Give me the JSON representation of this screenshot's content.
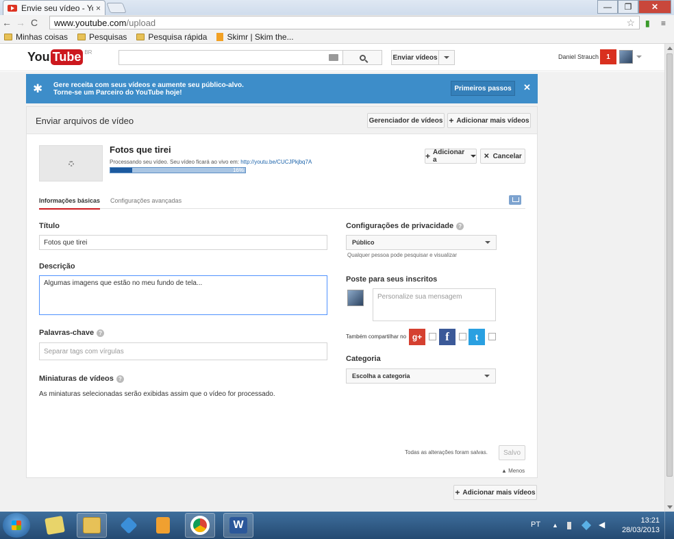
{
  "browser": {
    "tab_title": "Envie seu vídeo - You",
    "tab_close": "×",
    "url_host": "www.youtube.com",
    "url_path": "/upload",
    "window_controls": {
      "minimize": "—",
      "maximize": "❐",
      "close": "✕"
    },
    "nav": {
      "back": "←",
      "forward": "→",
      "reload": "C"
    },
    "bookmarks": [
      "Minhas coisas",
      "Pesquisas",
      "Pesquisa rápida",
      "Skimr | Skim the..."
    ]
  },
  "youtube_header": {
    "logo_you": "You",
    "logo_tube": "Tube",
    "logo_region": "BR",
    "search_placeholder": "",
    "upload_button": "Enviar vídeos",
    "username": "Daniel Strauch",
    "notification_count": "1"
  },
  "partner_banner": {
    "line1": "Gere receita com seus vídeos e aumente seu público-alvo.",
    "line2": "Torne-se um Parceiro do YouTube hoje!",
    "button": "Primeiros passos",
    "close": "✕"
  },
  "upload_panel": {
    "title": "Enviar arquivos de vídeo",
    "manager_button": "Gerenciador de vídeos",
    "add_more_button": "Adicionar mais vídeos",
    "plus": "+",
    "video": {
      "title": "Fotos que tirei",
      "processing_text": "Processando seu vídeo. Seu vídeo ficará ao vivo em:",
      "link": "http://youtu.be/CUCJPkjbq7A",
      "progress_label": "16%",
      "progress_value": 0.16
    },
    "add_to_button": "Adicionar a",
    "cancel_button": "Cancelar",
    "x": "✕",
    "tabs": {
      "basic": "Informações básicas",
      "advanced": "Configurações avançadas"
    },
    "form": {
      "title_label": "Título",
      "title_value": "Fotos que tirei",
      "description_label": "Descrição",
      "description_value": "Algumas imagens que estão no meu fundo de tela...",
      "tags_label": "Palavras-chave",
      "tags_placeholder": "Separar tags com vírgulas",
      "thumbnails_label": "Miniaturas de vídeos",
      "thumbnails_note": "As miniaturas selecionadas serão exibidas assim que o vídeo for processado.",
      "privacy_label": "Configurações de privacidade",
      "privacy_value": "Público",
      "privacy_note": "Qualquer pessoa pode pesquisar e visualizar",
      "post_label": "Poste para seus inscritos",
      "message_placeholder": "Personalize sua mensagem",
      "share_label": "Também compartilhar no",
      "category_label": "Categoria",
      "category_value": "Escolha a categoria",
      "help": "?"
    },
    "social": {
      "google": "g+",
      "facebook": "f",
      "twitter": "t"
    },
    "saved_note": "Todas as alterações foram salvas.",
    "saved_button": "Salvo",
    "less_link": "▲ Menos"
  },
  "taskbar": {
    "language": "PT",
    "time": "13:21",
    "date": "28/03/2013",
    "word_icon_letter": "W"
  },
  "colors": {
    "youtube_red": "#cc181e",
    "banner_blue": "#3d8dc9",
    "progress_blue": "#1c5a9f",
    "taskbar": "#254a72"
  },
  "icons": [
    "search-icon",
    "keyboard-icon",
    "star-icon",
    "upload-icon",
    "help-icon",
    "spinner-icon",
    "google-plus-icon",
    "facebook-icon",
    "twitter-icon",
    "windows-start-icon",
    "chrome-icon",
    "word-icon",
    "dropbox-icon",
    "folder-icon"
  ]
}
